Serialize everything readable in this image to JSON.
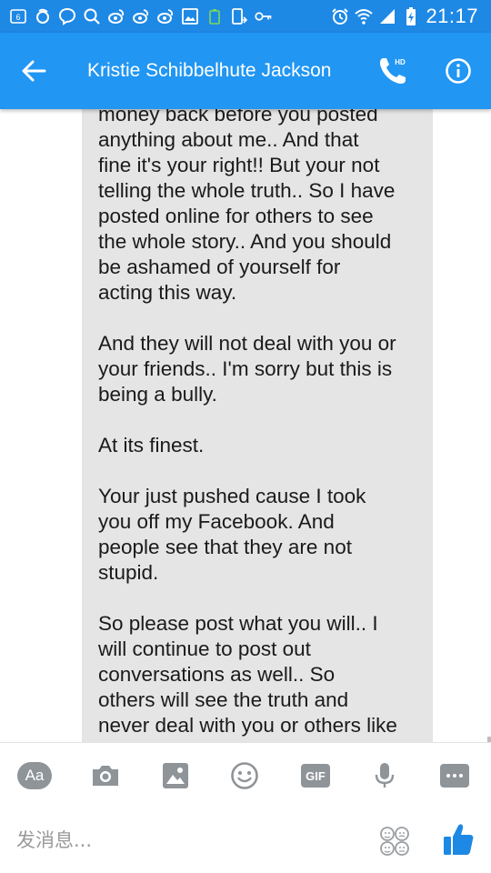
{
  "status_bar": {
    "time": "21:17"
  },
  "header": {
    "title": "Kristie Schibbelhute Jackson",
    "call_badge": "HD"
  },
  "conversation": {
    "paragraphs": [
      "money back before you posted\nanything about me.. And that\nfine it's your right!! But your not\ntelling the whole truth.. So I have\nposted online for others to see\nthe whole story.. And you should\nbe ashamed of yourself for\nacting this way.",
      "And they will not deal with you or\nyour friends.. I'm sorry but this is\nbeing a bully.",
      "At its finest.",
      "Your just pushed cause I took\nyou off my Facebook. And\npeople see that they are not\nstupid.",
      "So please post what you will.. I\nwill continue to post out\nconversations as well.. So\nothers will see the truth and\nnever deal with you or others like"
    ]
  },
  "toolbar": {
    "text_button": "Aa",
    "gif_button": "GIF"
  },
  "composer": {
    "placeholder": "发消息...",
    "value": ""
  },
  "colors": {
    "status_bar": "#1e88e5",
    "app_bar": "#2196f3",
    "bubble": "#e5e5e6",
    "icon_gray": "#8f9499",
    "like_blue": "#1e88e5"
  },
  "icons": {
    "status_left": [
      "notification-6-icon",
      "weibo-icon",
      "messenger-icon",
      "search-icon",
      "weibo-icon",
      "weibo-icon",
      "weibo-icon",
      "image-icon",
      "battery-saver-icon",
      "phone-transfer-icon",
      "key-icon"
    ],
    "status_right": [
      "alarm-icon",
      "wifi-icon",
      "signal-icon",
      "battery-charging-icon"
    ]
  }
}
